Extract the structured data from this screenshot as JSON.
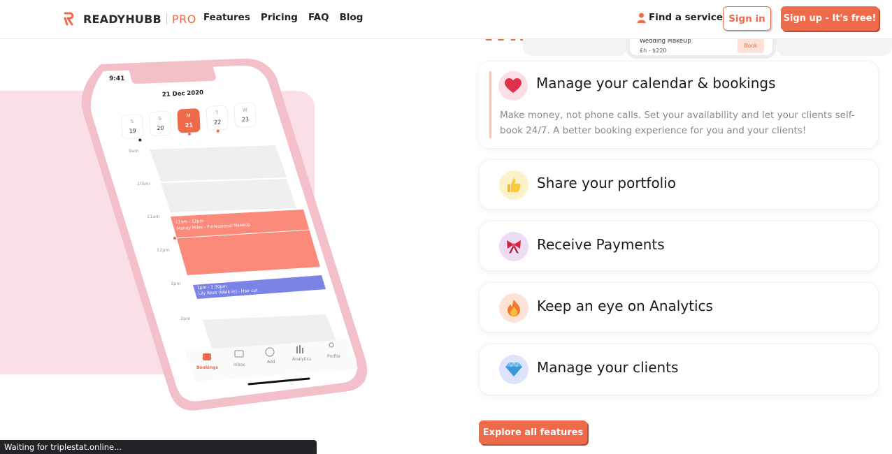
{
  "brand": {
    "name": "READYHUBB",
    "suffix": "PRO",
    "accent": "#ee6a4a"
  },
  "nav": {
    "items": [
      {
        "label": "Features"
      },
      {
        "label": "Pricing"
      },
      {
        "label": "FAQ"
      },
      {
        "label": "Blog"
      }
    ]
  },
  "header_actions": {
    "find_service": "Find a service",
    "sign_in": "Sign in",
    "sign_up": "Sign up - It's free!"
  },
  "peek": {
    "title_fragment": "Why",
    "booking_name": "Wedding MakeUp",
    "booking_price": "£h - $220",
    "booking_button": "Book"
  },
  "phone": {
    "time": "9:41",
    "date": "21 Dec 2020",
    "days": [
      {
        "letter": "S",
        "num": "19"
      },
      {
        "letter": "S",
        "num": "20"
      },
      {
        "letter": "M",
        "num": "21"
      },
      {
        "letter": "T",
        "num": "22"
      },
      {
        "letter": "W",
        "num": "23"
      }
    ],
    "hours": [
      "9am",
      "10am",
      "11am",
      "12pm",
      "1pm",
      "2pm"
    ],
    "event1_time": "11am - 12pm",
    "event1_title": "Mandy Miles - Professional MakeUp",
    "event2_time": "1pm - 1:30pm",
    "event2_title": "Lily Rose (Walk-in) - Hair cut",
    "tabs": [
      "Bookings",
      "Inbox",
      "Add",
      "Analytics",
      "Profile"
    ]
  },
  "features": [
    {
      "title": "Manage your calendar & bookings",
      "description": "Make money, not phone calls. Set your availability and let your clients self-book 24/7. A better booking experience for you and your clients!",
      "icon": "heart-icon",
      "icon_bg": "#fbdfe4"
    },
    {
      "title": "Share your portfolio",
      "icon": "thumbs-up-icon",
      "icon_bg": "#fdf1c9"
    },
    {
      "title": "Receive Payments",
      "icon": "ribbon-bow-icon",
      "icon_bg": "#ecdcf6"
    },
    {
      "title": "Keep an eye on Analytics",
      "icon": "fire-icon",
      "icon_bg": "#fde2d6"
    },
    {
      "title": "Manage your clients",
      "icon": "diamond-icon",
      "icon_bg": "#dde3fb"
    }
  ],
  "explore_label": "Explore all features",
  "status_text": "Waiting for triplestat.online..."
}
